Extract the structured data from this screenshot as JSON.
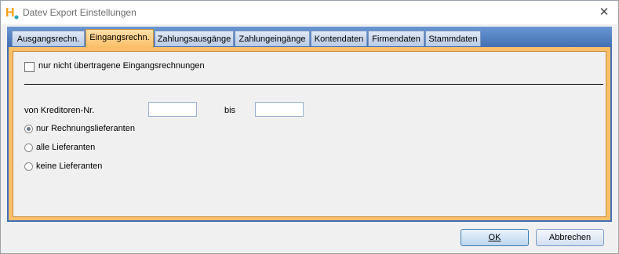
{
  "window": {
    "title": "Datev Export Einstellungen",
    "app_icon_letter": "H"
  },
  "tabs": [
    {
      "label": "Ausgangsrechn.",
      "active": false
    },
    {
      "label": "Eingangsrechn.",
      "active": true
    },
    {
      "label": "Zahlungsausgänge",
      "active": false
    },
    {
      "label": "Zahlungeingänge",
      "active": false
    },
    {
      "label": "Kontendaten",
      "active": false
    },
    {
      "label": "Firmendaten",
      "active": false
    },
    {
      "label": "Stammdaten",
      "active": false
    }
  ],
  "form": {
    "only_untransferred_label": "nur nicht übertragene Eingangsrechnungen",
    "only_untransferred_checked": false,
    "creditor_label": "von Kreditoren-Nr.",
    "creditor_from": "",
    "bis_label": "bis",
    "creditor_to": "",
    "radio_options": [
      {
        "label": "nur Rechnungslieferanten",
        "selected": true
      },
      {
        "label": "alle Lieferanten",
        "selected": false
      },
      {
        "label": "keine Lieferanten",
        "selected": false
      }
    ]
  },
  "buttons": {
    "ok_label": "OK",
    "cancel_label": "Abbrechen"
  },
  "colors": {
    "tab_strip": "#3f6fb5",
    "active_tab": "#fbbf6a",
    "panel_border": "#fbbf6a"
  }
}
